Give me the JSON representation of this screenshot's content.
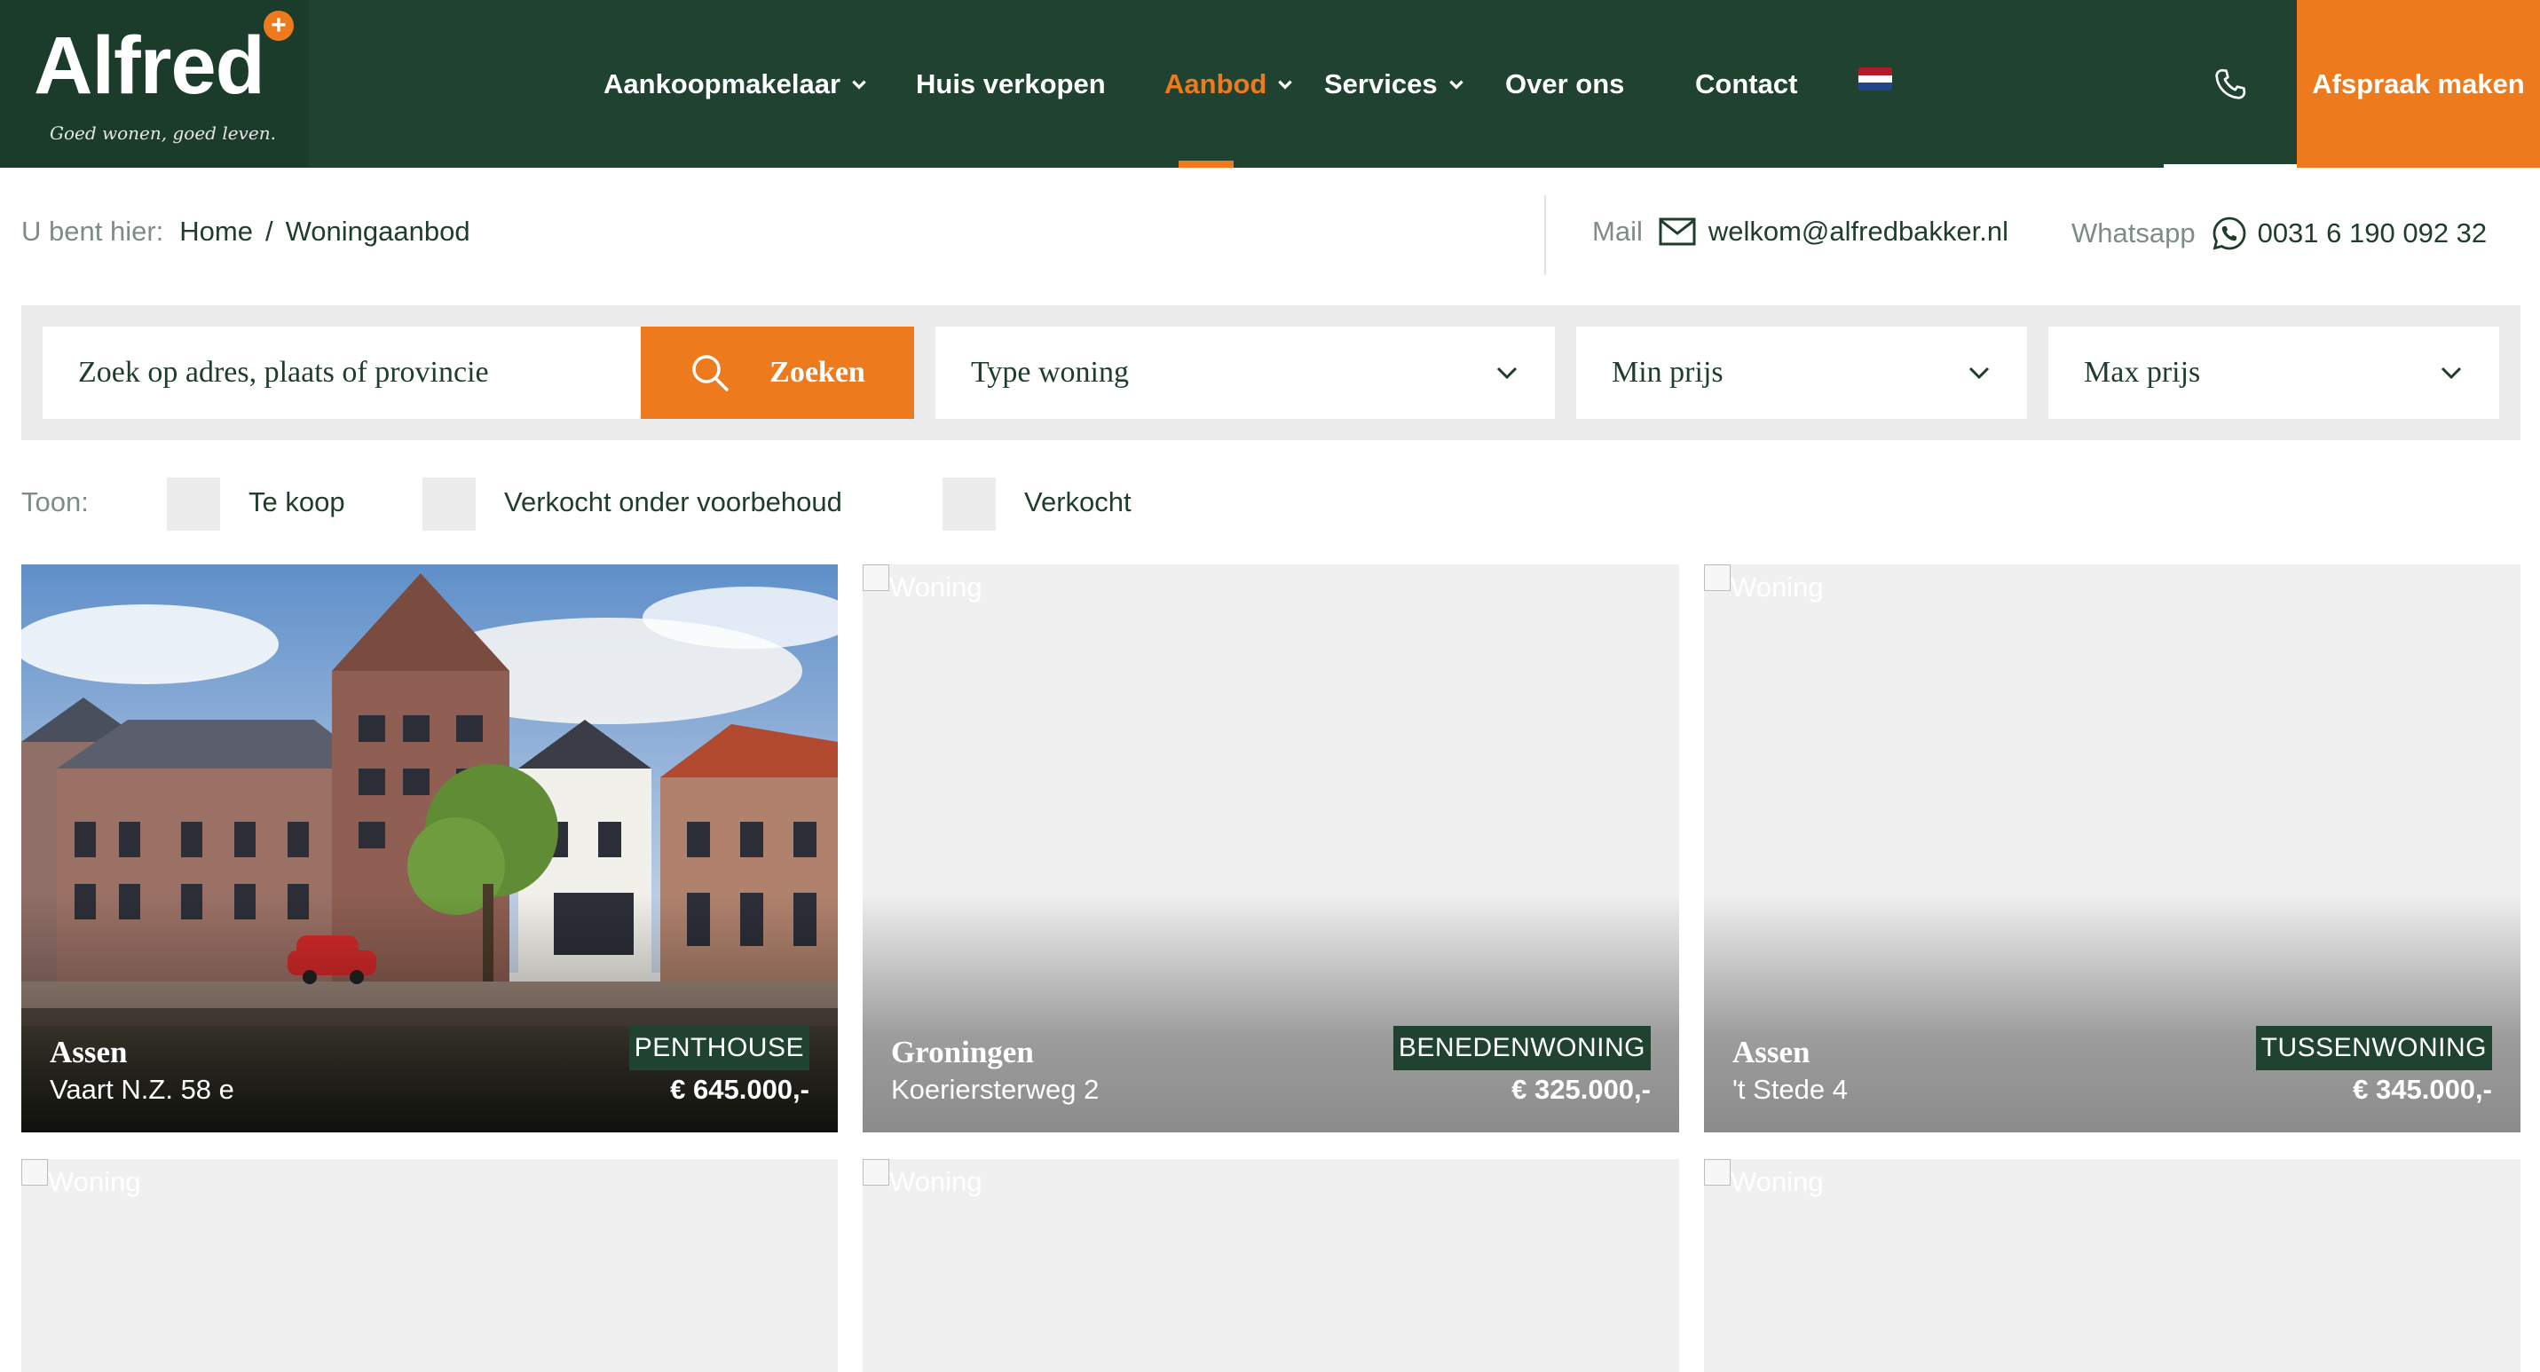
{
  "brand": {
    "name": "Alfred",
    "tagline": "Goed wonen, goed leven.",
    "accent": "#ee7a1e",
    "dark": "#1f4330"
  },
  "nav": {
    "items": [
      {
        "label": "Aankoopmakelaar",
        "dropdown": true
      },
      {
        "label": "Huis verkopen",
        "dropdown": false
      },
      {
        "label": "Aanbod",
        "dropdown": true,
        "active": true
      },
      {
        "label": "Services",
        "dropdown": true
      },
      {
        "label": "Over ons",
        "dropdown": false
      },
      {
        "label": "Contact",
        "dropdown": false
      }
    ],
    "language_icon": "dutch-flag-icon",
    "phone_icon": "phone-icon",
    "cta_label": "Afspraak maken"
  },
  "breadcrumb": {
    "prefix": "U bent hier:",
    "items": [
      "Home",
      "Woningaanbod"
    ],
    "separator": "/"
  },
  "contact": {
    "mail_label": "Mail",
    "mail": "welkom@alfredbakker.nl",
    "whatsapp_label": "Whatsapp",
    "whatsapp": "0031 6 190 092 32"
  },
  "search": {
    "placeholder": "Zoek op adres, plaats of provincie",
    "button_label": "Zoeken",
    "type_label": "Type woning",
    "min_label": "Min prijs",
    "max_label": "Max prijs"
  },
  "filters": {
    "label": "Toon:",
    "options": [
      "Te koop",
      "Verkocht onder voorbehoud",
      "Verkocht"
    ]
  },
  "listings": [
    {
      "city": "Assen",
      "street": "Vaart N.Z. 58 e",
      "type": "PENTHOUSE",
      "price": "€ 645.000,-",
      "image_alt": "Woning",
      "has_photo": true
    },
    {
      "city": "Groningen",
      "street": "Koeriersterweg 2",
      "type": "BENEDENWONING",
      "price": "€ 325.000,-",
      "image_alt": "Woning",
      "has_photo": false
    },
    {
      "city": "Assen",
      "street": "'t Stede 4",
      "type": "TUSSENWONING",
      "price": "€ 345.000,-",
      "image_alt": "Woning",
      "has_photo": false
    },
    {
      "image_alt": "Woning"
    },
    {
      "image_alt": "Woning"
    },
    {
      "image_alt": "Woning"
    }
  ]
}
